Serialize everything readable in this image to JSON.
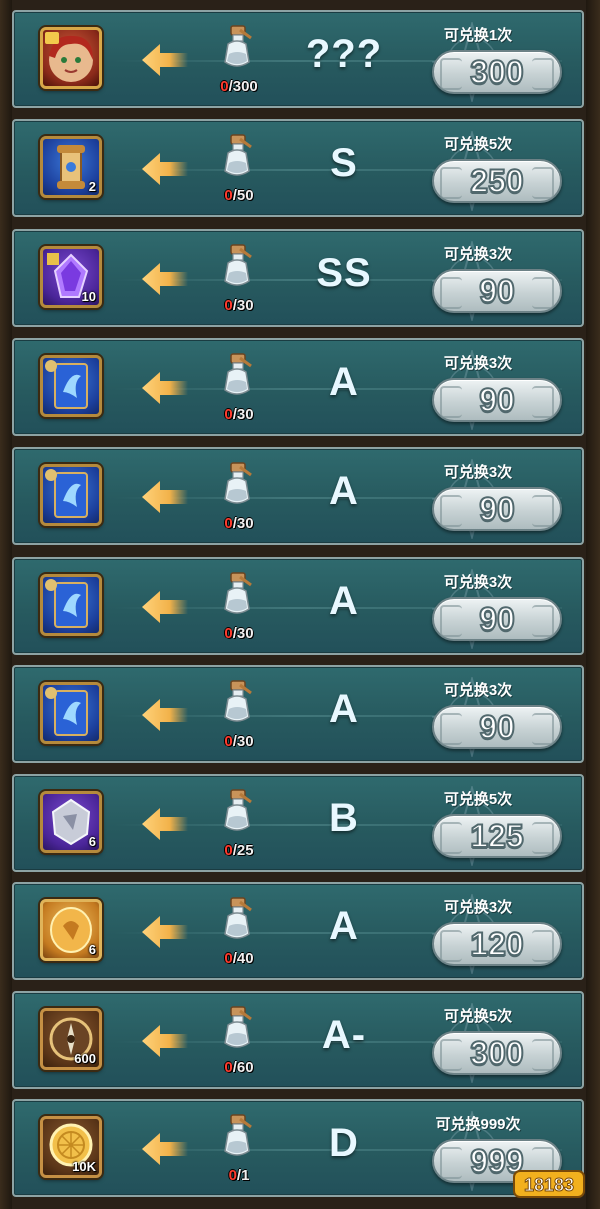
{
  "rows": [
    {
      "item": "hero-portrait",
      "frame": "red",
      "count": "",
      "cur": "0",
      "total": "/300",
      "grade": "???",
      "limit": "可兑换1次",
      "cost": "300"
    },
    {
      "item": "scroll",
      "frame": "blue",
      "count": "2",
      "cur": "0",
      "total": "/50",
      "grade": "S",
      "limit": "可兑换5次",
      "cost": "250"
    },
    {
      "item": "purple-crystal",
      "frame": "purple",
      "count": "10",
      "cur": "0",
      "total": "/30",
      "grade": "SS",
      "limit": "可兑换3次",
      "cost": "90"
    },
    {
      "item": "blue-card",
      "frame": "blue",
      "count": "",
      "cur": "0",
      "total": "/30",
      "grade": "A",
      "limit": "可兑换3次",
      "cost": "90"
    },
    {
      "item": "blue-card",
      "frame": "blue",
      "count": "",
      "cur": "0",
      "total": "/30",
      "grade": "A",
      "limit": "可兑换3次",
      "cost": "90"
    },
    {
      "item": "blue-card",
      "frame": "blue",
      "count": "",
      "cur": "0",
      "total": "/30",
      "grade": "A",
      "limit": "可兑换3次",
      "cost": "90"
    },
    {
      "item": "blue-card",
      "frame": "blue",
      "count": "",
      "cur": "0",
      "total": "/30",
      "grade": "A",
      "limit": "可兑换3次",
      "cost": "90"
    },
    {
      "item": "silver-rune",
      "frame": "purple",
      "count": "6",
      "cur": "0",
      "total": "/25",
      "grade": "B",
      "limit": "可兑换5次",
      "cost": "125"
    },
    {
      "item": "gold-rune",
      "frame": "gold",
      "count": "6",
      "cur": "0",
      "total": "/40",
      "grade": "A",
      "limit": "可兑换3次",
      "cost": "120"
    },
    {
      "item": "compass",
      "frame": "bronze",
      "count": "600",
      "cur": "0",
      "total": "/60",
      "grade": "A-",
      "limit": "可兑换5次",
      "cost": "300"
    },
    {
      "item": "gold-coin",
      "frame": "bronze",
      "count": "10K",
      "cur": "0",
      "total": "/1",
      "grade": "D",
      "limit": "可兑换999次",
      "cost": "999"
    }
  ],
  "watermark": "18183",
  "colors": {
    "panel": "#2b6468",
    "progress_current": "#ff3b2e",
    "grade_text": "#e8f8ff"
  }
}
